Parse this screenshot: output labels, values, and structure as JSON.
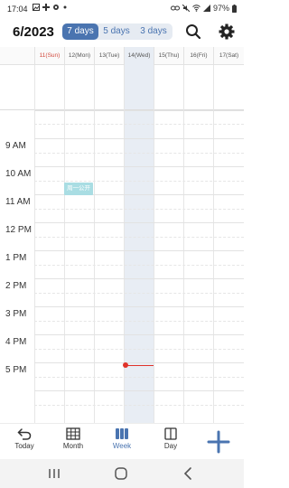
{
  "status_bar": {
    "time": "17:04",
    "battery": "97%"
  },
  "header": {
    "month_title": "6/2023",
    "range_options": [
      "7 days",
      "5 days",
      "3 days"
    ],
    "selected_range": "7 days"
  },
  "week": {
    "days": [
      {
        "date": "11",
        "weekday": "Sun"
      },
      {
        "date": "12",
        "weekday": "Mon"
      },
      {
        "date": "13",
        "weekday": "Tue"
      },
      {
        "date": "14",
        "weekday": "Wed"
      },
      {
        "date": "15",
        "weekday": "Thu"
      },
      {
        "date": "16",
        "weekday": "Fri"
      },
      {
        "date": "17",
        "weekday": "Sat"
      }
    ],
    "today_index": 3,
    "day_labels": [
      "11(Sun)",
      "12(Mon)",
      "13(Tue)",
      "14(Wed)",
      "15(Thu)",
      "16(Fri)",
      "17(Sat)"
    ],
    "time_labels": [
      "9 AM",
      "10 AM",
      "11 AM",
      "12 PM",
      "1 PM",
      "2 PM",
      "3 PM",
      "4 PM",
      "5 PM"
    ],
    "events": [
      {
        "title": "周一公开",
        "day": "12(Mon)",
        "start": "10:25",
        "end": "10:55"
      }
    ],
    "now_time": "17:04"
  },
  "bottom_nav": {
    "items": [
      {
        "label": "Today",
        "icon": "undo-arrow-icon"
      },
      {
        "label": "Month",
        "icon": "grid-calendar-icon"
      },
      {
        "label": "Week",
        "icon": "week-columns-icon"
      },
      {
        "label": "Day",
        "icon": "book-icon"
      }
    ],
    "active": "Week",
    "add_icon": "plus-icon"
  },
  "colors": {
    "accent": "#4a74b0",
    "today_column": "#e8edf4",
    "event": "#a9dde3",
    "now_line": "#e0332a",
    "sunday": "#d24a3e"
  }
}
